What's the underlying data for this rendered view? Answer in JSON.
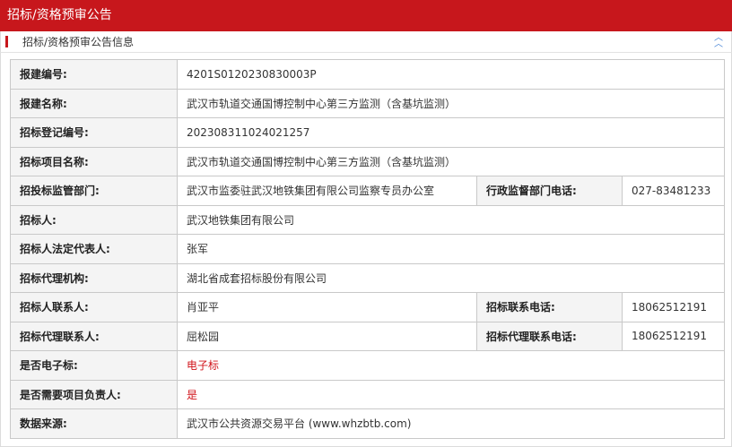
{
  "header": {
    "title": "招标/资格预审公告"
  },
  "section": {
    "title": "招标/资格预审公告信息"
  },
  "rows": [
    {
      "label": "报建编号:",
      "value": "4201S0120230830003P"
    },
    {
      "label": "报建名称:",
      "value": "武汉市轨道交通国博控制中心第三方监测（含基坑监测）"
    },
    {
      "label": "招标登记编号:",
      "value": "202308311024021257"
    },
    {
      "label": "招标项目名称:",
      "value": "武汉市轨道交通国博控制中心第三方监测（含基坑监测）"
    },
    {
      "label": "招投标监管部门:",
      "value": "武汉市监委驻武汉地铁集团有限公司监察专员办公室",
      "label2": "行政监督部门电话:",
      "value2": "027-83481233"
    },
    {
      "label": "招标人:",
      "value": "武汉地铁集团有限公司"
    },
    {
      "label": "招标人法定代表人:",
      "value": "张军"
    },
    {
      "label": "招标代理机构:",
      "value": "湖北省成套招标股份有限公司"
    },
    {
      "label": "招标人联系人:",
      "value": "肖亚平",
      "label2": "招标联系电话:",
      "value2": "18062512191"
    },
    {
      "label": "招标代理联系人:",
      "value": "屈松园",
      "label2": "招标代理联系电话:",
      "value2": "18062512191"
    },
    {
      "label": "是否电子标:",
      "value": "电子标"
    },
    {
      "label": "是否需要项目负责人:",
      "value": "是"
    },
    {
      "label": "数据来源:",
      "value": " 武汉市公共资源交易平台 (www.whzbtb.com)"
    }
  ],
  "colors": {
    "header_bg": "#c7171c",
    "accent_red": "#d1141b",
    "label_bg": "#f4f4f4",
    "collapse_blue": "#3f7fd4"
  },
  "icons": {
    "collapse": "double-chevron-up-icon"
  }
}
